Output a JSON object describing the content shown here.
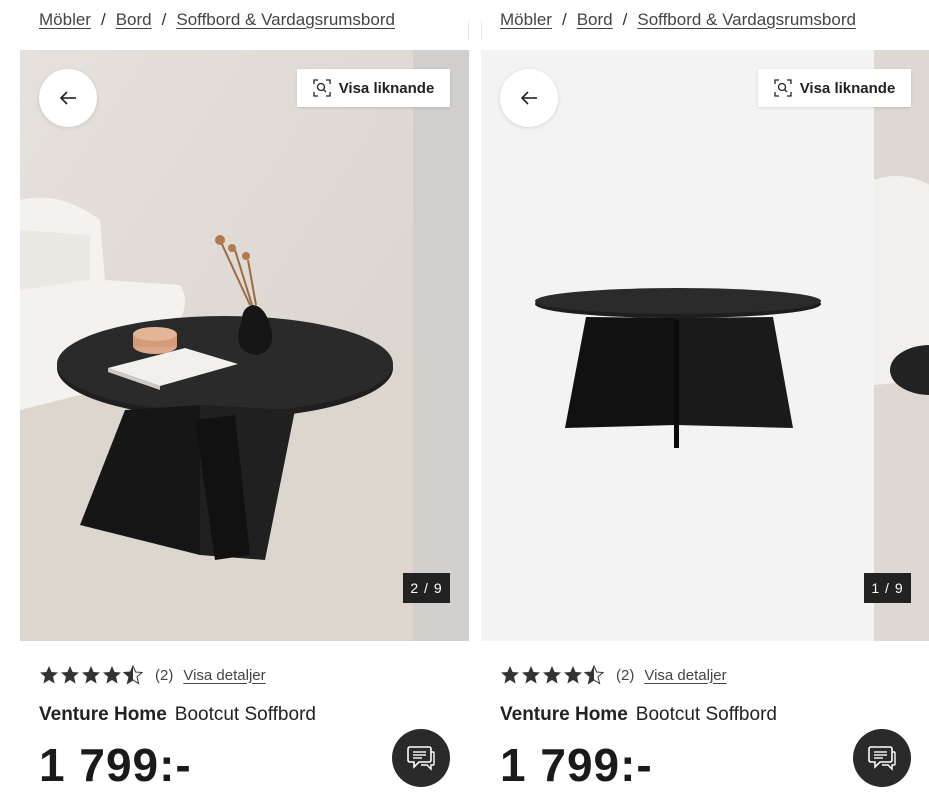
{
  "cards": [
    {
      "breadcrumb": [
        "Möbler",
        "Bord",
        "Soffbord & Vardagsrumsbord"
      ],
      "breadcrumb_separator": "/",
      "visa_label": "Visa liknande",
      "image_counter": "2 / 9",
      "rating_value": 4.5,
      "rating_count": "(2)",
      "details_link": "Visa detaljer",
      "brand": "Venture Home",
      "product_name": "Bootcut Soffbord",
      "price": "1 799:-"
    },
    {
      "breadcrumb": [
        "Möbler",
        "Bord",
        "Soffbord & Vardagsrumsbord"
      ],
      "breadcrumb_separator": "/",
      "visa_label": "Visa liknande",
      "image_counter": "1 / 9",
      "rating_value": 4.5,
      "rating_count": "(2)",
      "details_link": "Visa detaljer",
      "brand": "Venture Home",
      "product_name": "Bootcut Soffbord",
      "price": "1 799:-"
    }
  ],
  "icons": {
    "back": "arrow-left-icon",
    "visual_search": "visual-search-icon",
    "chat": "chat-icon",
    "star": "star-icon"
  },
  "colors": {
    "price_text": "#1a1a1a",
    "counter_bg": "#222222",
    "chat_bg": "#2a2a2a",
    "star": "#333333"
  }
}
